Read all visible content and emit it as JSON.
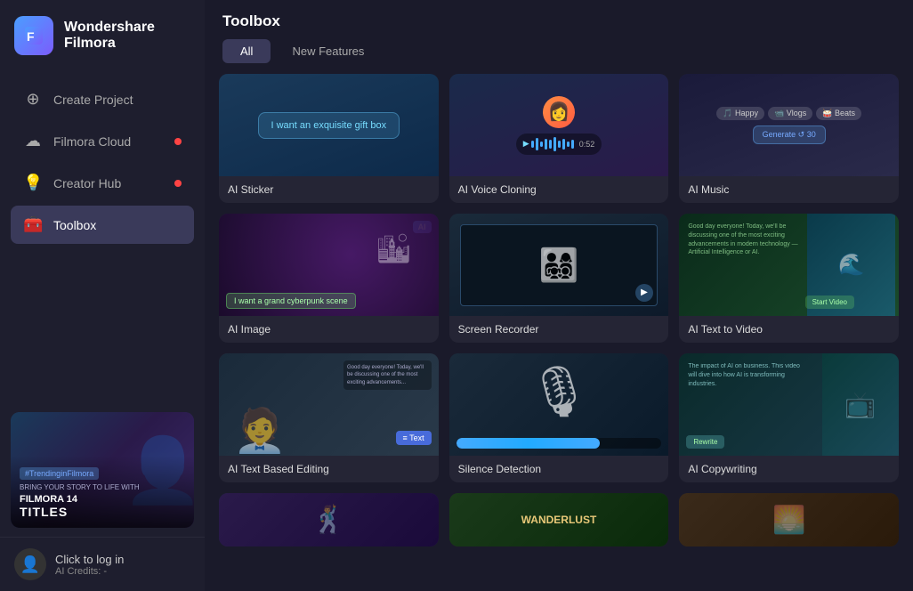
{
  "app": {
    "brand": "Wondershare",
    "product": "Filmora"
  },
  "titlebar": {
    "icons": [
      "wifi",
      "monitor",
      "cloud-upload",
      "grid",
      "bell"
    ],
    "window_buttons": [
      "minimize",
      "maximize",
      "close"
    ]
  },
  "sidebar": {
    "nav_items": [
      {
        "id": "create-project",
        "label": "Create Project",
        "icon": "plus-circle",
        "badge": false,
        "active": false
      },
      {
        "id": "filmora-cloud",
        "label": "Filmora Cloud",
        "icon": "cloud",
        "badge": true,
        "active": false
      },
      {
        "id": "creator-hub",
        "label": "Creator Hub",
        "icon": "lightbulb",
        "badge": true,
        "active": false
      },
      {
        "id": "toolbox",
        "label": "Toolbox",
        "icon": "toolbox",
        "badge": false,
        "active": true
      }
    ],
    "thumbnail": {
      "tag": "#TrendinginFilmora",
      "line1": "BRING YOUR STORY TO LIFE WITH",
      "line2": "FILMORA 14",
      "line3": "TITLES"
    },
    "footer": {
      "login_text": "Click to log in",
      "credits_label": "AI Credits: -"
    }
  },
  "main": {
    "title": "Toolbox",
    "tabs": [
      {
        "id": "all",
        "label": "All",
        "active": true
      },
      {
        "id": "new-features",
        "label": "New Features",
        "active": false
      }
    ],
    "cards": [
      {
        "id": "ai-sticker",
        "label": "AI Sticker",
        "has_ai_badge": false,
        "thumb_type": "ai-sticker",
        "prompt_text": "I want an exquisite gift box"
      },
      {
        "id": "ai-voice-cloning",
        "label": "AI Voice Cloning",
        "has_ai_badge": false,
        "thumb_type": "ai-voice",
        "wave_time": "0:52"
      },
      {
        "id": "ai-music",
        "label": "AI Music",
        "has_ai_badge": false,
        "thumb_type": "ai-music",
        "tags": [
          "Happy",
          "Vlogs",
          "Beats"
        ],
        "generate_label": "Generate ↺ 30"
      },
      {
        "id": "ai-image",
        "label": "AI Image",
        "has_ai_badge": true,
        "thumb_type": "ai-image",
        "prompt_text": "I want a grand cyberpunk scene"
      },
      {
        "id": "screen-recorder",
        "label": "Screen Recorder",
        "has_ai_badge": false,
        "thumb_type": "screen-rec"
      },
      {
        "id": "ai-text-to-video",
        "label": "AI Text to Video",
        "has_ai_badge": true,
        "thumb_type": "ai-text-video",
        "sample_text": "Good day everyone! Today, we'll be discussing one of the most exciting advancements in modern technology — Artificial Intelligence or AI. AI is a computer system that can perform tasks that normally require human intelligence, such as visual perception, speech recognition, decision-making, and language translation."
      },
      {
        "id": "ai-text-based-editing",
        "label": "AI Text Based Editing",
        "has_ai_badge": true,
        "thumb_type": "text-edit"
      },
      {
        "id": "silence-detection",
        "label": "Silence Detection",
        "has_ai_badge": true,
        "thumb_type": "silence"
      },
      {
        "id": "ai-copywriting",
        "label": "AI Copywriting",
        "has_ai_badge": true,
        "thumb_type": "copywrite",
        "copy_text": "The impact of AI on business. This video will dive into how AI is transforming industries."
      },
      {
        "id": "partial-1",
        "label": "",
        "has_ai_badge": true,
        "thumb_type": "partial1"
      },
      {
        "id": "partial-2",
        "label": "",
        "has_ai_badge": true,
        "thumb_type": "partial2",
        "wanderlust": "WANDERLUST"
      },
      {
        "id": "partial-3",
        "label": "",
        "has_ai_badge": true,
        "thumb_type": "partial3"
      }
    ]
  },
  "colors": {
    "sidebar_bg": "#1e1e2e",
    "main_bg": "#1a1a2a",
    "card_bg": "#252535",
    "accent": "#4a9eff",
    "active_nav": "#3a3a5a",
    "badge_red": "#ff4444"
  }
}
